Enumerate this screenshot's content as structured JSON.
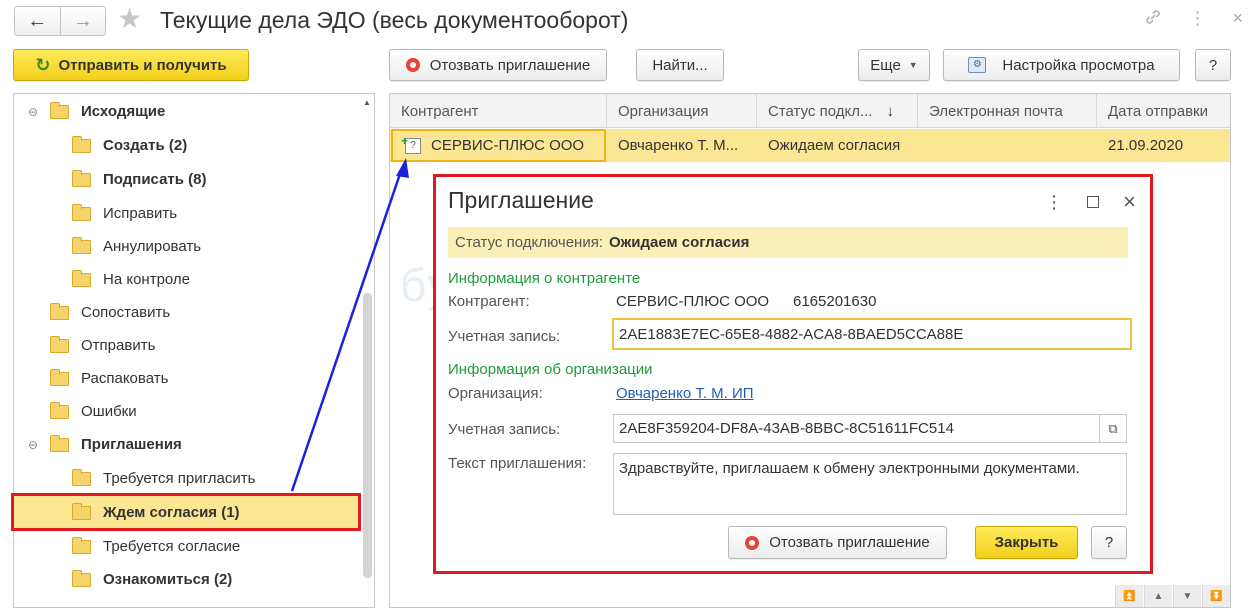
{
  "window": {
    "title": "Текущие дела ЭДО (весь документооборот)",
    "back_icon": "←",
    "forward_icon": "→",
    "star_icon": "★",
    "link_icon": "🔗",
    "menu_icon": "⋮",
    "close_icon": "×"
  },
  "toolbar": {
    "send_receive": "Отправить и получить",
    "revoke_invite": "Отозвать приглашение",
    "find": "Найти...",
    "more": "Еще",
    "view_settings": "Настройка просмотра",
    "help": "?"
  },
  "tree": {
    "items": [
      {
        "label": "Исходящие",
        "bold": true,
        "level": 0,
        "expander": "⊖"
      },
      {
        "label": "Создать (2)",
        "bold": true,
        "level": 1
      },
      {
        "label": "Подписать (8)",
        "bold": true,
        "level": 1
      },
      {
        "label": "Исправить",
        "bold": false,
        "level": 1
      },
      {
        "label": "Аннулировать",
        "bold": false,
        "level": 1
      },
      {
        "label": "На контроле",
        "bold": false,
        "level": 1
      },
      {
        "label": "Сопоставить",
        "bold": false,
        "level": 0
      },
      {
        "label": "Отправить",
        "bold": false,
        "level": 0
      },
      {
        "label": "Распаковать",
        "bold": false,
        "level": 0
      },
      {
        "label": "Ошибки",
        "bold": false,
        "level": 0
      },
      {
        "label": "Приглашения",
        "bold": true,
        "level": 0,
        "expander": "⊖"
      },
      {
        "label": "Требуется пригласить",
        "bold": false,
        "level": 1
      },
      {
        "label": "Ждем согласия (1)",
        "bold": true,
        "level": 1,
        "selected": true
      },
      {
        "label": "Требуется согласие",
        "bold": false,
        "level": 1
      },
      {
        "label": "Ознакомиться (2)",
        "bold": true,
        "level": 1
      }
    ]
  },
  "table": {
    "columns": [
      "Контрагент",
      "Организация",
      "Статус подкл...",
      "Электронная почта",
      "Дата отправки"
    ],
    "sort_icon": "↓",
    "rows": [
      {
        "counterparty": "СЕРВИС-ПЛЮС ООО",
        "organization": "Овчаренко Т. М...",
        "status": "Ожидаем согласия",
        "email": "",
        "date": "21.09.2020"
      }
    ]
  },
  "dialog": {
    "title": "Приглашение",
    "status_label": "Статус подключения:",
    "status_value": "Ожидаем согласия",
    "section_counterparty": "Информация о контрагенте",
    "counterparty_label": "Контрагент:",
    "counterparty_name": "СЕРВИС-ПЛЮС ООО",
    "counterparty_inn": "6165201630",
    "account_label": "Учетная запись:",
    "counterparty_account": "2AE1883E7EC-65E8-4882-ACA8-8BAED5CCA88E",
    "section_org": "Информация об организации",
    "org_label": "Организация:",
    "org_value": "Овчаренко Т. М. ИП",
    "org_account_label": "Учетная запись:",
    "org_account": "2AE8F359204-DF8A-43AB-8BBC-8C51611FC514",
    "message_label": "Текст приглашения:",
    "message_text": "Здравствуйте, приглашаем к обмену электронными документами.",
    "revoke_button": "Отозвать приглашение",
    "close_button": "Закрыть",
    "help_button": "?"
  },
  "colors": {
    "accent_yellow": "#f3cf1a",
    "selection": "#fbe694",
    "highlight_border": "#e3171f",
    "arrow": "#1a22e0",
    "section_green": "#1f9c3c",
    "link_blue": "#1f5fb4"
  }
}
